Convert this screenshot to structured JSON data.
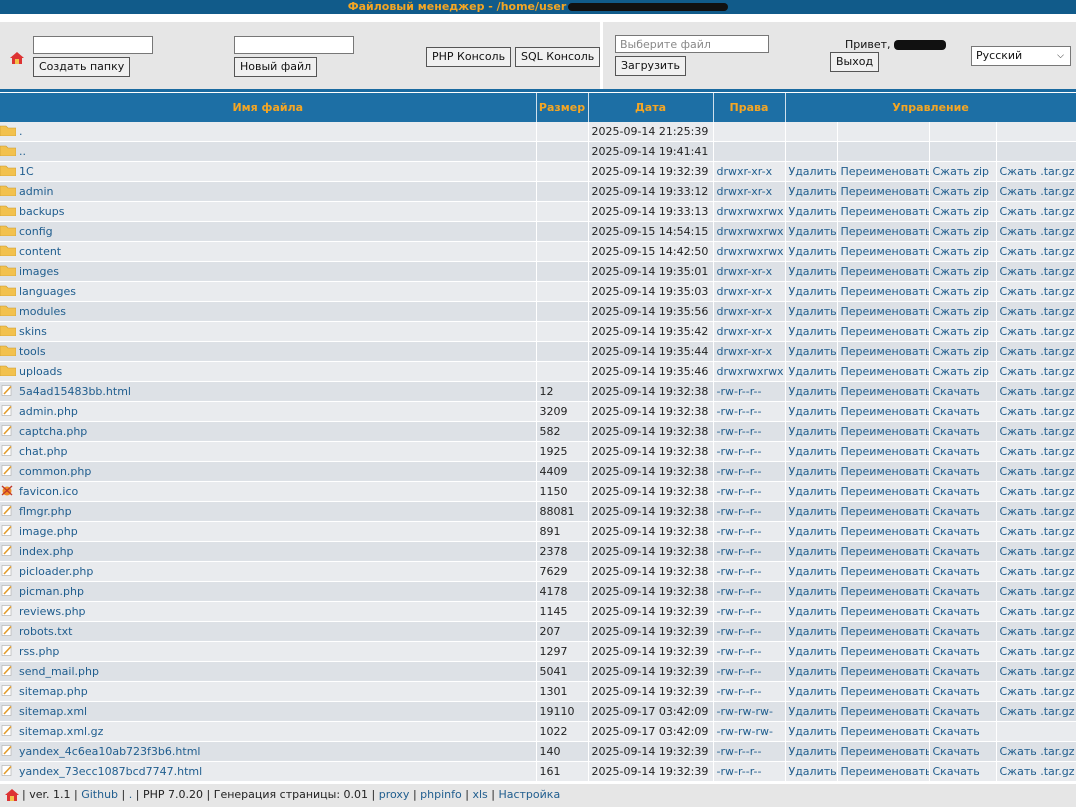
{
  "window": {
    "title": "Файловый менеджер - /home/user"
  },
  "toolbar": {
    "create_folder": "Создать папку",
    "new_file": "Новый файл",
    "php_console": "PHP Консоль",
    "sql_console": "SQL Консоль",
    "file_placeholder": "Выберите файл",
    "upload": "Загрузить",
    "hello": "Привет,",
    "logout": "Выход",
    "language": "Русский"
  },
  "table": {
    "headers": [
      "Имя файла",
      "Размер",
      "Дата",
      "Права",
      "Управление"
    ],
    "rows": [
      {
        "type": "folder",
        "name": ".",
        "size": "",
        "date": "2025-09-14 21:25:39",
        "perm": "",
        "a1": "",
        "a2": "",
        "a3": "",
        "a4": ""
      },
      {
        "type": "folder",
        "name": "..",
        "size": "",
        "date": "2025-09-14 19:41:41",
        "perm": "",
        "a1": "",
        "a2": "",
        "a3": "",
        "a4": ""
      },
      {
        "type": "folder",
        "name": "1C",
        "size": "",
        "date": "2025-09-14 19:32:39",
        "perm": "drwxr-xr-x",
        "a1": "Удалить",
        "a2": "Переименовать",
        "a3": "Сжать zip",
        "a4": "Сжать .tar.gz"
      },
      {
        "type": "folder",
        "name": "admin",
        "size": "",
        "date": "2025-09-14 19:33:12",
        "perm": "drwxr-xr-x",
        "a1": "Удалить",
        "a2": "Переименовать",
        "a3": "Сжать zip",
        "a4": "Сжать .tar.gz"
      },
      {
        "type": "folder",
        "name": "backups",
        "size": "",
        "date": "2025-09-14 19:33:13",
        "perm": "drwxrwxrwx",
        "a1": "Удалить",
        "a2": "Переименовать",
        "a3": "Сжать zip",
        "a4": "Сжать .tar.gz"
      },
      {
        "type": "folder",
        "name": "config",
        "size": "",
        "date": "2025-09-15 14:54:15",
        "perm": "drwxrwxrwx",
        "a1": "Удалить",
        "a2": "Переименовать",
        "a3": "Сжать zip",
        "a4": "Сжать .tar.gz"
      },
      {
        "type": "folder",
        "name": "content",
        "size": "",
        "date": "2025-09-15 14:42:50",
        "perm": "drwxrwxrwx",
        "a1": "Удалить",
        "a2": "Переименовать",
        "a3": "Сжать zip",
        "a4": "Сжать .tar.gz"
      },
      {
        "type": "folder",
        "name": "images",
        "size": "",
        "date": "2025-09-14 19:35:01",
        "perm": "drwxr-xr-x",
        "a1": "Удалить",
        "a2": "Переименовать",
        "a3": "Сжать zip",
        "a4": "Сжать .tar.gz"
      },
      {
        "type": "folder",
        "name": "languages",
        "size": "",
        "date": "2025-09-14 19:35:03",
        "perm": "drwxr-xr-x",
        "a1": "Удалить",
        "a2": "Переименовать",
        "a3": "Сжать zip",
        "a4": "Сжать .tar.gz"
      },
      {
        "type": "folder",
        "name": "modules",
        "size": "",
        "date": "2025-09-14 19:35:56",
        "perm": "drwxr-xr-x",
        "a1": "Удалить",
        "a2": "Переименовать",
        "a3": "Сжать zip",
        "a4": "Сжать .tar.gz"
      },
      {
        "type": "folder",
        "name": "skins",
        "size": "",
        "date": "2025-09-14 19:35:42",
        "perm": "drwxr-xr-x",
        "a1": "Удалить",
        "a2": "Переименовать",
        "a3": "Сжать zip",
        "a4": "Сжать .tar.gz"
      },
      {
        "type": "folder",
        "name": "tools",
        "size": "",
        "date": "2025-09-14 19:35:44",
        "perm": "drwxr-xr-x",
        "a1": "Удалить",
        "a2": "Переименовать",
        "a3": "Сжать zip",
        "a4": "Сжать .tar.gz"
      },
      {
        "type": "folder",
        "name": "uploads",
        "size": "",
        "date": "2025-09-14 19:35:46",
        "perm": "drwxrwxrwx",
        "a1": "Удалить",
        "a2": "Переименовать",
        "a3": "Сжать zip",
        "a4": "Сжать .tar.gz"
      },
      {
        "type": "file",
        "name": "5a4ad15483bb.html",
        "size": "12",
        "date": "2025-09-14 19:32:38",
        "perm": "-rw-r--r--",
        "a1": "Удалить",
        "a2": "Переименовать",
        "a3": "Скачать",
        "a4": "Сжать .tar.gz"
      },
      {
        "type": "file",
        "name": "admin.php",
        "size": "3209",
        "date": "2025-09-14 19:32:38",
        "perm": "-rw-r--r--",
        "a1": "Удалить",
        "a2": "Переименовать",
        "a3": "Скачать",
        "a4": "Сжать .tar.gz"
      },
      {
        "type": "file",
        "name": "captcha.php",
        "size": "582",
        "date": "2025-09-14 19:32:38",
        "perm": "-rw-r--r--",
        "a1": "Удалить",
        "a2": "Переименовать",
        "a3": "Скачать",
        "a4": "Сжать .tar.gz"
      },
      {
        "type": "file",
        "name": "chat.php",
        "size": "1925",
        "date": "2025-09-14 19:32:38",
        "perm": "-rw-r--r--",
        "a1": "Удалить",
        "a2": "Переименовать",
        "a3": "Скачать",
        "a4": "Сжать .tar.gz"
      },
      {
        "type": "file",
        "name": "common.php",
        "size": "4409",
        "date": "2025-09-14 19:32:38",
        "perm": "-rw-r--r--",
        "a1": "Удалить",
        "a2": "Переименовать",
        "a3": "Скачать",
        "a4": "Сжать .tar.gz"
      },
      {
        "type": "ico",
        "name": "favicon.ico",
        "size": "1150",
        "date": "2025-09-14 19:32:38",
        "perm": "-rw-r--r--",
        "a1": "Удалить",
        "a2": "Переименовать",
        "a3": "Скачать",
        "a4": "Сжать .tar.gz"
      },
      {
        "type": "file",
        "name": "flmgr.php",
        "size": "88081",
        "date": "2025-09-14 19:32:38",
        "perm": "-rw-r--r--",
        "a1": "Удалить",
        "a2": "Переименовать",
        "a3": "Скачать",
        "a4": "Сжать .tar.gz"
      },
      {
        "type": "file",
        "name": "image.php",
        "size": "891",
        "date": "2025-09-14 19:32:38",
        "perm": "-rw-r--r--",
        "a1": "Удалить",
        "a2": "Переименовать",
        "a3": "Скачать",
        "a4": "Сжать .tar.gz"
      },
      {
        "type": "file",
        "name": "index.php",
        "size": "2378",
        "date": "2025-09-14 19:32:38",
        "perm": "-rw-r--r--",
        "a1": "Удалить",
        "a2": "Переименовать",
        "a3": "Скачать",
        "a4": "Сжать .tar.gz"
      },
      {
        "type": "file",
        "name": "picloader.php",
        "size": "7629",
        "date": "2025-09-14 19:32:38",
        "perm": "-rw-r--r--",
        "a1": "Удалить",
        "a2": "Переименовать",
        "a3": "Скачать",
        "a4": "Сжать .tar.gz"
      },
      {
        "type": "file",
        "name": "picman.php",
        "size": "4178",
        "date": "2025-09-14 19:32:38",
        "perm": "-rw-r--r--",
        "a1": "Удалить",
        "a2": "Переименовать",
        "a3": "Скачать",
        "a4": "Сжать .tar.gz"
      },
      {
        "type": "file",
        "name": "reviews.php",
        "size": "1145",
        "date": "2025-09-14 19:32:39",
        "perm": "-rw-r--r--",
        "a1": "Удалить",
        "a2": "Переименовать",
        "a3": "Скачать",
        "a4": "Сжать .tar.gz"
      },
      {
        "type": "file",
        "name": "robots.txt",
        "size": "207",
        "date": "2025-09-14 19:32:39",
        "perm": "-rw-r--r--",
        "a1": "Удалить",
        "a2": "Переименовать",
        "a3": "Скачать",
        "a4": "Сжать .tar.gz"
      },
      {
        "type": "file",
        "name": "rss.php",
        "size": "1297",
        "date": "2025-09-14 19:32:39",
        "perm": "-rw-r--r--",
        "a1": "Удалить",
        "a2": "Переименовать",
        "a3": "Скачать",
        "a4": "Сжать .tar.gz"
      },
      {
        "type": "file",
        "name": "send_mail.php",
        "size": "5041",
        "date": "2025-09-14 19:32:39",
        "perm": "-rw-r--r--",
        "a1": "Удалить",
        "a2": "Переименовать",
        "a3": "Скачать",
        "a4": "Сжать .tar.gz"
      },
      {
        "type": "file",
        "name": "sitemap.php",
        "size": "1301",
        "date": "2025-09-14 19:32:39",
        "perm": "-rw-r--r--",
        "a1": "Удалить",
        "a2": "Переименовать",
        "a3": "Скачать",
        "a4": "Сжать .tar.gz"
      },
      {
        "type": "file",
        "name": "sitemap.xml",
        "size": "19110",
        "date": "2025-09-17 03:42:09",
        "perm": "-rw-rw-rw-",
        "a1": "Удалить",
        "a2": "Переименовать",
        "a3": "Скачать",
        "a4": "Сжать .tar.gz"
      },
      {
        "type": "file",
        "name": "sitemap.xml.gz",
        "size": "1022",
        "date": "2025-09-17 03:42:09",
        "perm": "-rw-rw-rw-",
        "a1": "Удалить",
        "a2": "Переименовать",
        "a3": "Скачать",
        "a4": ""
      },
      {
        "type": "file",
        "name": "yandex_4c6ea10ab723f3b6.html",
        "size": "140",
        "date": "2025-09-14 19:32:39",
        "perm": "-rw-r--r--",
        "a1": "Удалить",
        "a2": "Переименовать",
        "a3": "Скачать",
        "a4": "Сжать .tar.gz"
      },
      {
        "type": "file",
        "name": "yandex_73ecc1087bcd7747.html",
        "size": "161",
        "date": "2025-09-14 19:32:39",
        "perm": "-rw-r--r--",
        "a1": "Удалить",
        "a2": "Переименовать",
        "a3": "Скачать",
        "a4": "Сжать .tar.gz"
      }
    ]
  },
  "footer": {
    "version": "ver. 1.1",
    "github": "Github",
    "dot": ".",
    "php": "PHP 7.0.20",
    "gen": "Генерация страницы: 0.01",
    "proxy": "proxy",
    "phpinfo": "phpinfo",
    "xls": "xls",
    "settings": "Настройка",
    "sep": "|"
  },
  "colors": {
    "header_bg": "#1d6fa5",
    "header_text": "#f5a623",
    "link": "#1f5d8e"
  }
}
